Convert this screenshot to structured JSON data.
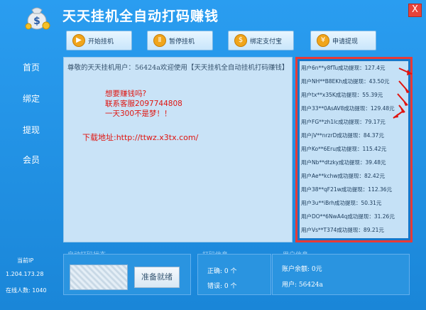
{
  "window": {
    "title": "天天挂机全自动打码赚钱",
    "close_label": "X"
  },
  "toolbar": [
    {
      "label": "开始挂机",
      "icon": "play-icon",
      "glyph": "▶"
    },
    {
      "label": "暂停挂机",
      "icon": "pause-icon",
      "glyph": "Ⅱ"
    },
    {
      "label": "绑定支付宝",
      "icon": "dollar-icon",
      "glyph": "$"
    },
    {
      "label": "申请提现",
      "icon": "moneybag-icon",
      "glyph": "¥"
    }
  ],
  "sidebar": {
    "items": [
      "首页",
      "绑定",
      "提现",
      "会员"
    ]
  },
  "info": {
    "welcome": "尊敬的天天挂机用户：56424a欢迎使用【天天挂机全自动挂机打码赚钱】",
    "promo_line1": "想要赚钱吗?",
    "promo_line2": "联系客服2097744808",
    "promo_line3": "一天300不是梦！！",
    "download": "下载地址:http://ttwz.x3tx.com/"
  },
  "withdrawals": [
    "用户6n**y8fTu成功提现：127.4元",
    "用户NH**B8EKh成功提现：43.50元",
    "用户tx**x35K成功提现：55.39元",
    "用户33**0AsAV8成功提现：129.48元",
    "用户FG**zh1lc成功提现：79.17元",
    "用户jV**nrzrD成功提现：84.37元",
    "用户Ko**6Eru成功提现：115.42元",
    "用户Nb**dtzky成功提现：39.48元",
    "用户Ae**kchw成功提现：82.42元",
    "用户38**qF21w成功提现：112.36元",
    "用户3u**iBrh成功提现：50.31元",
    "用户DO**6NwA4q成功提现：31.26元",
    "用户Vs**T374成功提现：89.21元"
  ],
  "status": {
    "version_label": "当前IP",
    "ip": "1.204.173.28",
    "online_label": "在线人数: 1040"
  },
  "auto_code": {
    "group_label": "自动打码状态",
    "ready_label": "准备就绪"
  },
  "code_info": {
    "group_label": "打码信息",
    "correct": "正确: 0 个",
    "wrong": "错误: 0 个"
  },
  "user_info": {
    "group_label": "用户信息",
    "balance": "账户余额: 0元",
    "user": "用户: 56424a"
  },
  "colors": {
    "accent_red": "#e83a36",
    "background_blue": "#1f8fe0"
  }
}
